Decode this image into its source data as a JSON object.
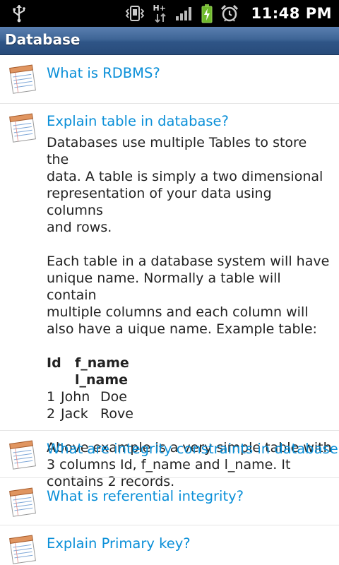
{
  "status_bar": {
    "time": "11:48 PM",
    "network_label": "H+",
    "icons": [
      "usb-icon",
      "vibrate-icon",
      "network-hplus-icon",
      "signal-icon",
      "battery-charging-icon",
      "alarm-icon"
    ]
  },
  "title_bar": {
    "title": "Database"
  },
  "list": {
    "items": [
      {
        "question": "What is RDBMS?",
        "icon": "notepad-icon"
      },
      {
        "question": "Explain table in database?",
        "icon": "notepad-icon"
      },
      {
        "question": "What are integrity constraints in database?",
        "icon": "notepad-icon"
      },
      {
        "question": "What is referential integrity?",
        "icon": "notepad-icon"
      },
      {
        "question": "Explain Primary key?",
        "icon": "notepad-icon"
      }
    ],
    "expanded_answer": {
      "lines1": [
        "Databases use multiple Tables to store the",
        "data. A table is simply a two dimensional",
        "representation of your data using columns",
        "and rows."
      ],
      "lines2": [
        "Each table in a database system will have",
        "unique name. Normally a table will contain",
        "multiple columns and each column will",
        "also have a uique name. Example table:"
      ],
      "table": {
        "headers": [
          "Id",
          "f_name l_name"
        ],
        "rows": [
          [
            "1",
            "John",
            "Doe"
          ],
          [
            "2",
            "Jack",
            "Rove"
          ]
        ]
      },
      "lines3": [
        "Above example is a very simple table with",
        "3 columns Id, f_name and l_name. It",
        "contains 2 records."
      ]
    }
  },
  "colors": {
    "status_bar": "#000000",
    "title_bar": "#3e6596",
    "question_text": "#0a8fd8",
    "answer_text": "#222222",
    "background": "#ffffff"
  }
}
